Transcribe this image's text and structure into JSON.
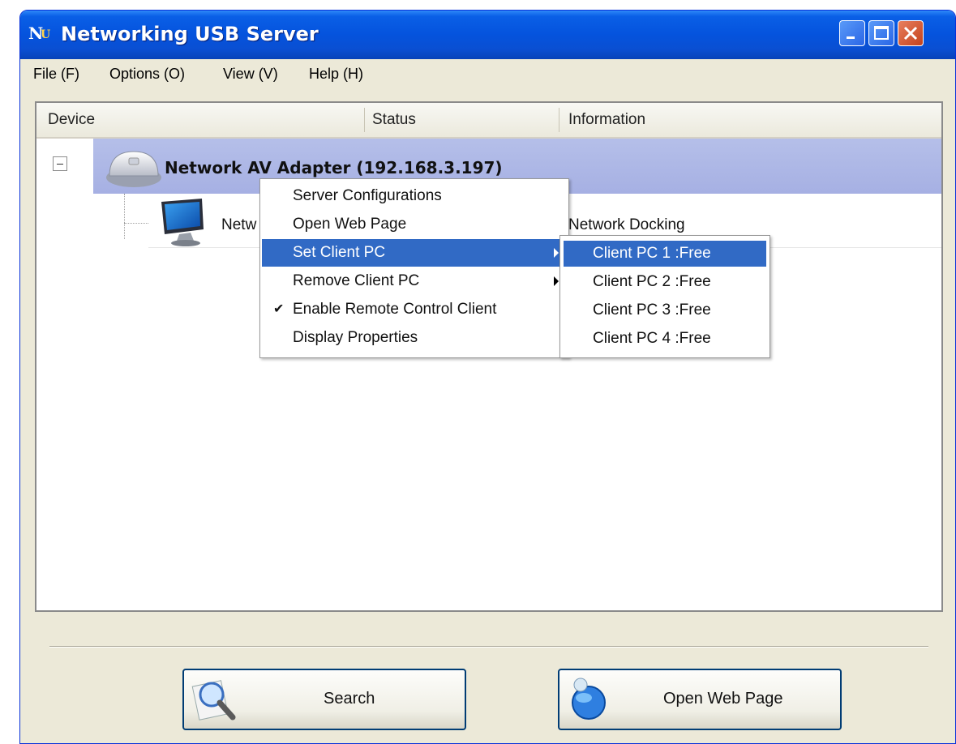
{
  "window": {
    "title": "Networking USB Server",
    "logo_text_n": "N",
    "logo_text_u": "U"
  },
  "menubar": {
    "items": [
      "File (F)",
      "Options (O)",
      "View (V)",
      "Help (H)"
    ]
  },
  "table": {
    "columns": [
      "Device",
      "Status",
      "Information"
    ],
    "adapter": {
      "label": "Network AV Adapter  (192.168.3.197)"
    },
    "sub_device": {
      "name": "Netw",
      "information": "Network Docking"
    }
  },
  "context_menu": {
    "items": [
      {
        "label": "Server Configurations"
      },
      {
        "label": "Open Web Page"
      },
      {
        "label": "Set Client PC"
      },
      {
        "label": "Remove Client PC"
      },
      {
        "label": "Enable Remote Control Client",
        "checked": true
      },
      {
        "label": "Display Properties"
      }
    ],
    "check_glyph": "✔"
  },
  "submenu": {
    "items": [
      "Client PC 1 :Free",
      "Client PC 2 :Free",
      "Client PC 3 :Free",
      "Client PC 4 :Free"
    ]
  },
  "buttons": {
    "search": "Search",
    "open_web_page": "Open Web Page"
  },
  "colors": {
    "titlebar": "#0553dd",
    "highlight": "#316ac5",
    "adapter_row": "#aab3e5",
    "window_bg": "#ece9d8"
  }
}
